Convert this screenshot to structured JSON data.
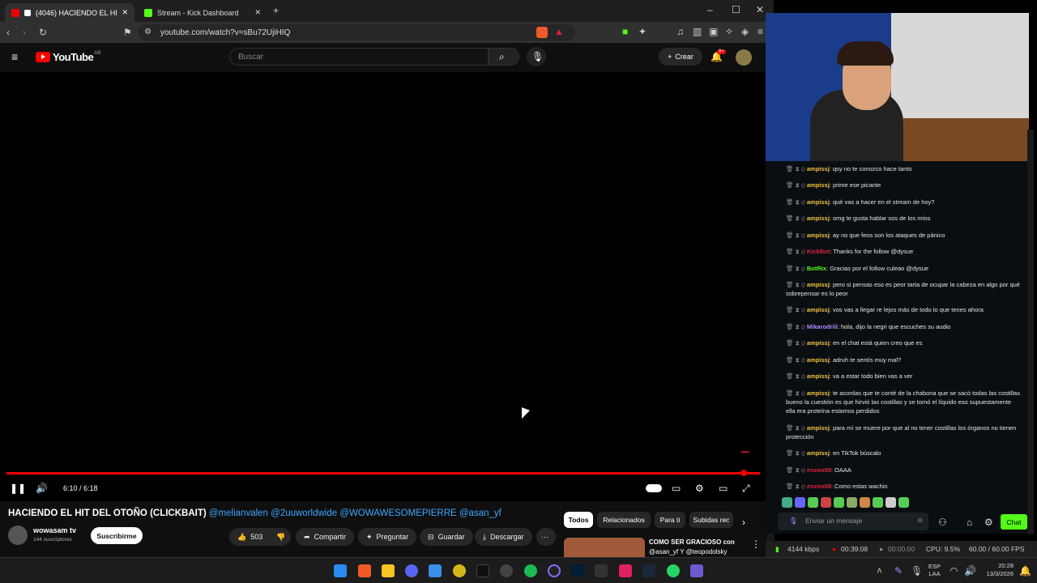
{
  "browser": {
    "tabs": [
      {
        "label": "(4046) HACIENDO EL HIT DEL",
        "active": true
      },
      {
        "label": "Stream - Kick Dashboard",
        "active": false
      }
    ],
    "url": "youtube.com/watch?v=sBu72UjiHIQ"
  },
  "youtube": {
    "logo": "YouTube",
    "region": "AR",
    "search_placeholder": "Buscar",
    "create_label": "Crear",
    "notif_count": "9+",
    "time": "6:10 / 6:18",
    "progress": 0.984,
    "title": "HACIENDO EL HIT DEL OTOÑO (CLICKBAIT)",
    "mentions": "@melianvalen @2uuworldwide @WOWAWESOMEPIERRE @asan_yf",
    "channel": "wowasam tv",
    "subs": "144 suscriptores",
    "subscribe": "Suscribirme",
    "likes": "503",
    "share": "Compartir",
    "ask": "Preguntar",
    "save": "Guardar",
    "download": "Descargar",
    "chips": [
      "Todos",
      "Relacionados",
      "Para ti",
      "Subidas rec"
    ],
    "reco_title": "COMO SER GRACIOSO con",
    "reco_sub": "@asan_yf Y @teopodolsky"
  },
  "chat": {
    "messages": [
      {
        "user": "ampissj",
        "color": "#f0c040",
        "text": ": qsy no te conozco hace tanto"
      },
      {
        "user": "ampissj",
        "color": "#f0c040",
        "text": ": prime ese picante"
      },
      {
        "user": "ampissj",
        "color": "#f0c040",
        "text": ": qué vas a hacer en el stream de hoy?"
      },
      {
        "user": "ampissj",
        "color": "#f0c040",
        "text": ": omg te gusta hablar sos de los míos"
      },
      {
        "user": "ampissj",
        "color": "#f0c040",
        "text": ": ay no que feos son los ataques de pánico"
      },
      {
        "user": "KickBot",
        "color": "#e02040",
        "text": ": Thanks for the follow @dysue"
      },
      {
        "user": "BotRix",
        "color": "#53fc18",
        "text": ": Gracias por el follow culeao @dysue"
      },
      {
        "user": "ampissj",
        "color": "#f0c040",
        "text": ": pero si pensas eso es peor tarta de ocupar la cabeza en algo por qué sobrepensar es lo peor"
      },
      {
        "user": "ampissj",
        "color": "#f0c040",
        "text": ": vos vas a llegar re lejos más de todo lo que tenes ahora"
      },
      {
        "user": "Mikarodrili",
        "color": "#b088ff",
        "text": ": hola, dijo la negri que escuches su audio"
      },
      {
        "user": "ampissj",
        "color": "#f0c040",
        "text": ": en el chat está quien creo que es"
      },
      {
        "user": "ampissj",
        "color": "#f0c040",
        "text": ": adruh te sentís muy mal?"
      },
      {
        "user": "ampissj",
        "color": "#f0c040",
        "text": ": va a estar todo bien vas a ver"
      },
      {
        "user": "ampissj",
        "color": "#f0c040",
        "text": ": te acordas que te conté de la chabona que se sacó todas las costillas bueno la cuestión es que hirvió las costillas y se tomó el líquido eso supuestamente ella era proteína estamos perdidos"
      },
      {
        "user": "ampissj",
        "color": "#f0c040",
        "text": ": para mí se muere por que al no tener costillas los órganos no tienen protección"
      },
      {
        "user": "ampissj",
        "color": "#f0c040",
        "text": ": en TikTok búscalo"
      },
      {
        "user": "enzoo08",
        "color": "#e02040",
        "text": ": OAAA"
      },
      {
        "user": "enzoo08",
        "color": "#e02040",
        "text": ": Como estas wachin"
      }
    ],
    "input_placeholder": "Enviar un mensaje",
    "chat_button": "Chat"
  },
  "status": {
    "bitrate": "4144 kbps",
    "live_time": "00:39:08",
    "rec_time": "00:00:00",
    "cpu": "CPU: 9.5%",
    "fps": "60.00 / 60.00 FPS"
  },
  "taskbar": {
    "lang": "ESP",
    "lang2": "LAA",
    "time": "20:28",
    "date": "13/3/2026"
  }
}
